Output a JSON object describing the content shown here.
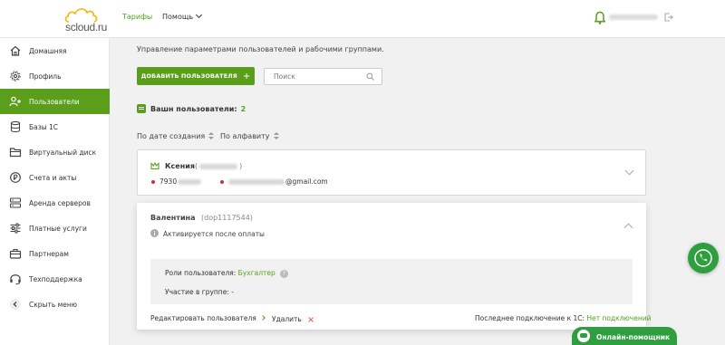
{
  "header": {
    "logo_text": "scloud.ru",
    "nav_tariffs": "Тарифы",
    "nav_help": "Помощь"
  },
  "sidebar": {
    "items": [
      {
        "label": "Домашняя",
        "icon": "home-icon"
      },
      {
        "label": "Профиль",
        "icon": "gear-icon"
      },
      {
        "label": "Пользователи",
        "icon": "add-user-icon"
      },
      {
        "label": "Базы 1С",
        "icon": "database-icon"
      },
      {
        "label": "Виртуальный диск",
        "icon": "folder-icon"
      },
      {
        "label": "Счета и акты",
        "icon": "ruble-icon"
      },
      {
        "label": "Аренда серверов",
        "icon": "server-icon"
      },
      {
        "label": "Платные услуги",
        "icon": "sliders-icon"
      },
      {
        "label": "Партнерам",
        "icon": "briefcase-icon"
      },
      {
        "label": "Техподдержка",
        "icon": "headset-icon"
      },
      {
        "label": "Скрыть меню",
        "icon": "chevron-left-icon"
      }
    ],
    "active_index": 2
  },
  "main": {
    "intro": "Управление параметрами пользователей и рабочими группами.",
    "add_user_button": "ДОБАВИТЬ ПОЛЬЗОВАТЕЛЯ",
    "search_placeholder": "Поиск",
    "users_label": "Вашн пользователи:",
    "users_count": "2",
    "sort_by_date": "По дате создания",
    "sort_alpha": "По алфавиту"
  },
  "users": [
    {
      "name": "Ксения",
      "phone_prefix": "7930",
      "email_suffix": "@gmail.com"
    },
    {
      "name": "Валентина",
      "login": "(dop1117544)",
      "status": "Активируется после оплаты",
      "roles_label": "Роли пользователя:",
      "role": "Бухгалтер",
      "group_label": "Участие в группе:",
      "group_value": "-",
      "edit_label": "Редактировать пользователя",
      "delete_label": "Удалить",
      "last_connection_label": "Последнее подключение к 1С:",
      "last_connection_value": "Нет подключений"
    }
  ],
  "floating": {
    "chat_label": "Онлайн-помощник"
  },
  "colors": {
    "accent": "#5a9e1c",
    "call_green": "#2e9e3e",
    "danger": "#cc3333"
  }
}
